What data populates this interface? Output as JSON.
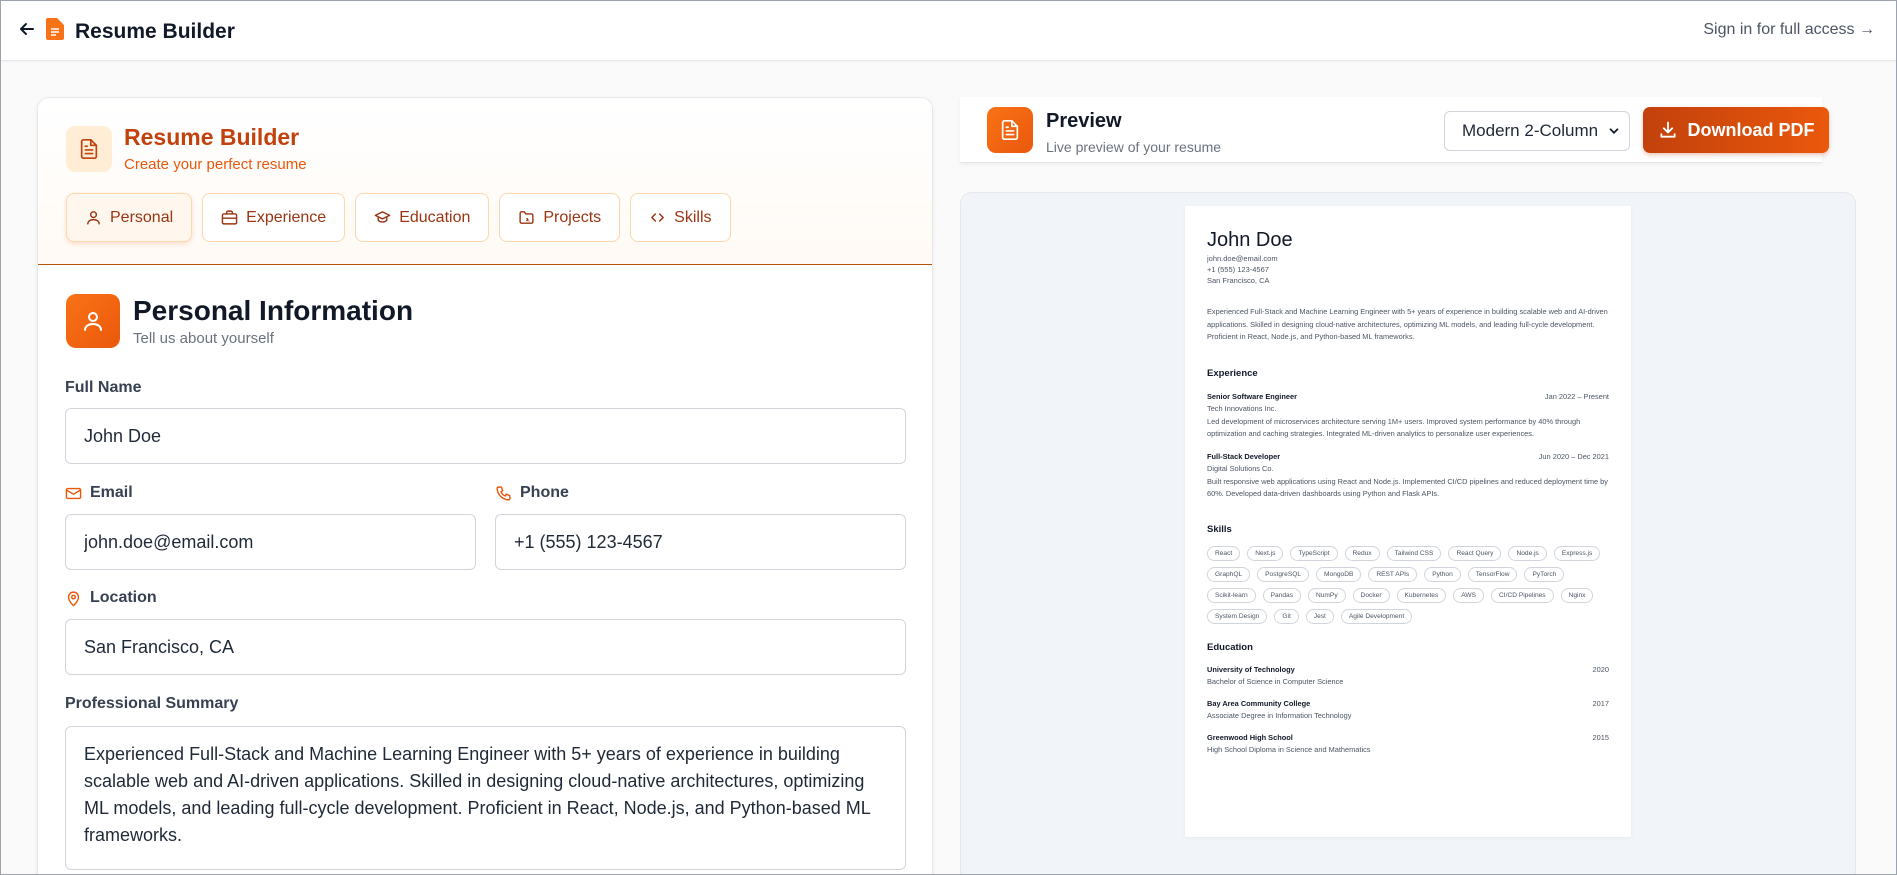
{
  "topbar": {
    "title": "Resume Builder",
    "signin": "Sign in for full access →"
  },
  "editor": {
    "title": "Resume Builder",
    "subtitle": "Create your perfect resume",
    "tabs": [
      {
        "label": "Personal",
        "icon": "user-icon",
        "active": true
      },
      {
        "label": "Experience",
        "icon": "briefcase-icon",
        "active": false
      },
      {
        "label": "Education",
        "icon": "graduation-cap-icon",
        "active": false
      },
      {
        "label": "Projects",
        "icon": "folder-icon",
        "active": false
      },
      {
        "label": "Skills",
        "icon": "code-icon",
        "active": false
      }
    ],
    "section": {
      "title": "Personal Information",
      "subtitle": "Tell us about yourself"
    },
    "fields": {
      "full_name": {
        "label": "Full Name",
        "value": "John Doe"
      },
      "email": {
        "label": "Email",
        "value": "john.doe@email.com"
      },
      "phone": {
        "label": "Phone",
        "value": "+1 (555) 123-4567"
      },
      "location": {
        "label": "Location",
        "value": "San Francisco, CA"
      },
      "summary": {
        "label": "Professional Summary",
        "value": "Experienced Full-Stack and Machine Learning Engineer with 5+ years of experience in building scalable web and AI-driven applications. Skilled in designing cloud-native architectures, optimizing ML models, and leading full-cycle development. Proficient in React, Node.js, and Python-based ML frameworks."
      }
    }
  },
  "preview": {
    "title": "Preview",
    "subtitle": "Live preview of your resume",
    "template": "Modern 2-Column",
    "download_label": "Download PDF",
    "resume": {
      "name": "John Doe",
      "email": "john.doe@email.com",
      "phone": "+1 (555) 123-4567",
      "location": "San Francisco, CA",
      "summary": "Experienced Full-Stack and Machine Learning Engineer with 5+ years of experience in building scalable web and AI-driven applications. Skilled in designing cloud-native architectures, optimizing ML models, and leading full-cycle development. Proficient in React, Node.js, and Python-based ML frameworks.",
      "experience_heading": "Experience",
      "experience": [
        {
          "title": "Senior Software Engineer",
          "dates": "Jan 2022 – Present",
          "company": "Tech Innovations Inc.",
          "desc": "Led development of microservices architecture serving 1M+ users. Improved system performance by 40% through optimization and caching strategies. Integrated ML-driven analytics to personalize user experiences."
        },
        {
          "title": "Full-Stack Developer",
          "dates": "Jun 2020 – Dec 2021",
          "company": "Digital Solutions Co.",
          "desc": "Built responsive web applications using React and Node.js. Implemented CI/CD pipelines and reduced deployment time by 60%. Developed data-driven dashboards using Python and Flask APIs."
        }
      ],
      "skills_heading": "Skills",
      "skills": [
        "React",
        "Next.js",
        "TypeScript",
        "Redux",
        "Tailwind CSS",
        "React Query",
        "Node.js",
        "Express.js",
        "GraphQL",
        "PostgreSQL",
        "MongoDB",
        "REST APIs",
        "Python",
        "TensorFlow",
        "PyTorch",
        "Scikit-learn",
        "Pandas",
        "NumPy",
        "Docker",
        "Kubernetes",
        "AWS",
        "CI/CD Pipelines",
        "Nginx",
        "System Design",
        "Git",
        "Jest",
        "Agile Development"
      ],
      "education_heading": "Education",
      "education": [
        {
          "school": "University of Technology",
          "year": "2020",
          "degree": "Bachelor of Science in Computer Science"
        },
        {
          "school": "Bay Area Community College",
          "year": "2017",
          "degree": "Associate Degree in Information Technology"
        },
        {
          "school": "Greenwood High School",
          "year": "2015",
          "degree": "High School Diploma in Science and Mathematics"
        }
      ]
    }
  },
  "colors": {
    "accent": "#ea580c",
    "accent_dark": "#c2410c",
    "accent_light": "#ffedd5"
  }
}
